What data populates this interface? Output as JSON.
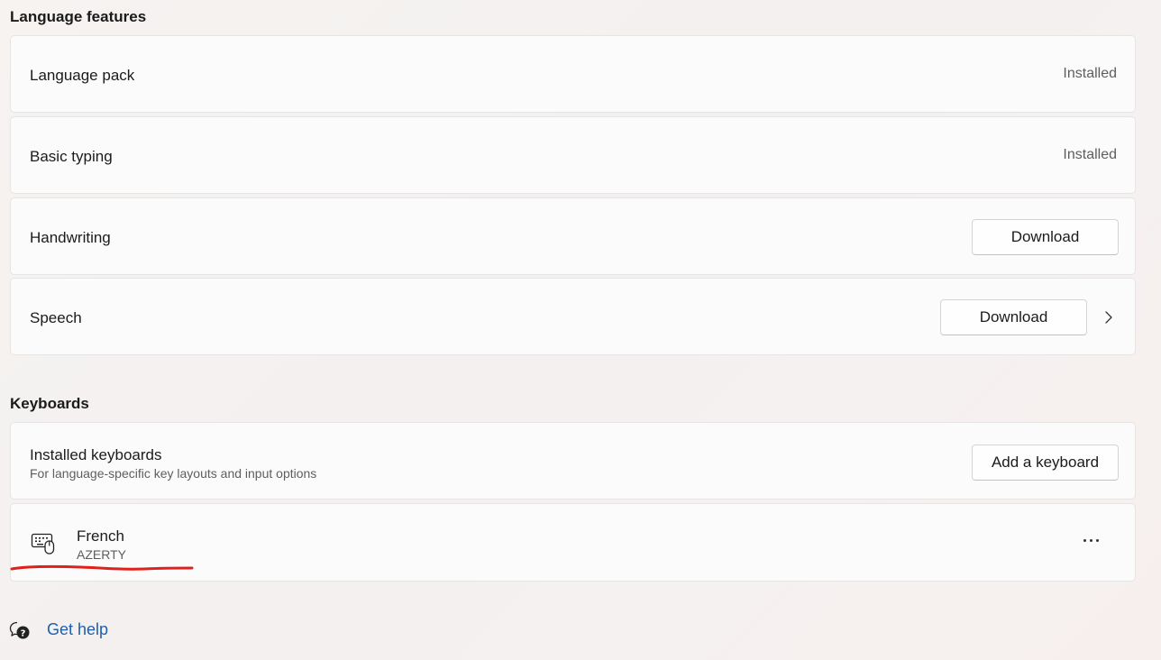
{
  "language_features": {
    "heading": "Language features",
    "items": [
      {
        "label": "Language pack",
        "status": "Installed"
      },
      {
        "label": "Basic typing",
        "status": "Installed"
      },
      {
        "label": "Handwriting",
        "button": "Download"
      },
      {
        "label": "Speech",
        "button": "Download"
      }
    ]
  },
  "keyboards": {
    "heading": "Keyboards",
    "installed_title": "Installed keyboards",
    "installed_desc": "For language-specific key layouts and input options",
    "add_button": "Add a keyboard",
    "keyboard_item": {
      "name": "French",
      "layout": "AZERTY",
      "icon": "keyboard-icon"
    }
  },
  "help": {
    "label": "Get help",
    "icon": "help-icon"
  },
  "colors": {
    "accent_link": "#1f5fad",
    "annotation": "#e0201b"
  }
}
